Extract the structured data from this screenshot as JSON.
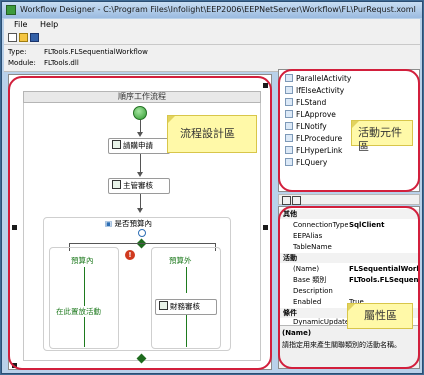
{
  "window": {
    "title": "Workflow Designer - C:\\Program Files\\Infolight\\EEP2006\\EEPNetServer\\Workflow\\FL\\PurRequst.xoml"
  },
  "menu": [
    "File",
    "Help"
  ],
  "info": {
    "type_label": "Type:",
    "type_value": "FLTools.FLSequentialWorkflow",
    "module_label": "Module:",
    "module_value": "FLTools.dll"
  },
  "designer": {
    "flow_title": "順序工作流程",
    "activities": {
      "request": "請購申請",
      "supervisor": "主管審核",
      "if_label": "是否預算內",
      "branch_in": "預算內",
      "branch_out": "預算外",
      "skip": "在此置放活動",
      "finance": "財務審核"
    },
    "note": "流程設計區"
  },
  "toolbox": {
    "items": [
      "ParallelActivity",
      "IfElseActivity",
      "FLStand",
      "FLApprove",
      "FLNotify",
      "FLProcedure",
      "FLHyperLink",
      "FLQuery"
    ],
    "note": "活動元件區"
  },
  "properties": {
    "rows": [
      {
        "name": "其他",
        "value": "",
        "category": true
      },
      {
        "name": "ConnectionType",
        "value": "SqlClient",
        "bold": true
      },
      {
        "name": "EEPAlias",
        "value": ""
      },
      {
        "name": "TableName",
        "value": ""
      },
      {
        "name": "活動",
        "value": "",
        "category": true
      },
      {
        "name": "(Name)",
        "value": "FLSequentialWorkflo",
        "bold": true
      },
      {
        "name": "Base 類別",
        "value": "FLTools.FLSequentia",
        "bold": true
      },
      {
        "name": "Description",
        "value": ""
      },
      {
        "name": "Enabled",
        "value": "True"
      },
      {
        "name": "條件",
        "value": "",
        "category": true
      },
      {
        "name": "DynamicUpdateCo",
        "value": ""
      }
    ],
    "desc_title": "(Name)",
    "desc_text": "請指定用來產生關聯類別的活動名稱。",
    "note": "屬性區"
  },
  "colors": {
    "highlight_border": "#d21f3c",
    "note_fill": "#fff9a8",
    "title_bar": "#9bbbe0"
  }
}
